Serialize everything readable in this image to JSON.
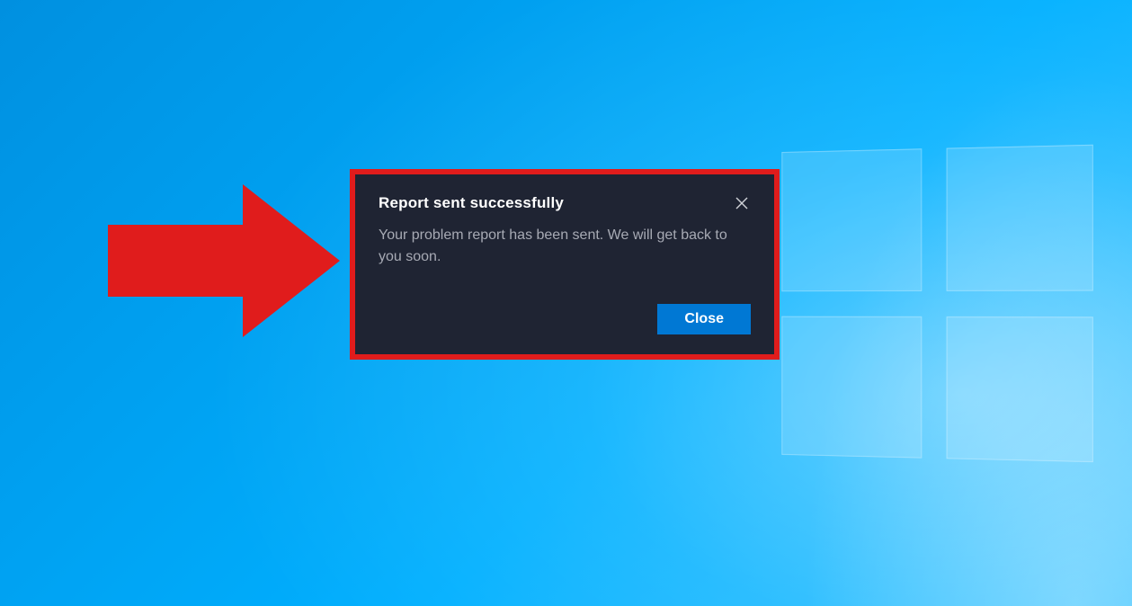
{
  "dialog": {
    "title": "Report sent successfully",
    "body": "Your problem report has been sent. We will get back to you soon.",
    "close_button_label": "Close"
  },
  "colors": {
    "annotation_outline": "#e01c1c",
    "dialog_background": "#1f2433",
    "primary_button": "#0078d4"
  }
}
